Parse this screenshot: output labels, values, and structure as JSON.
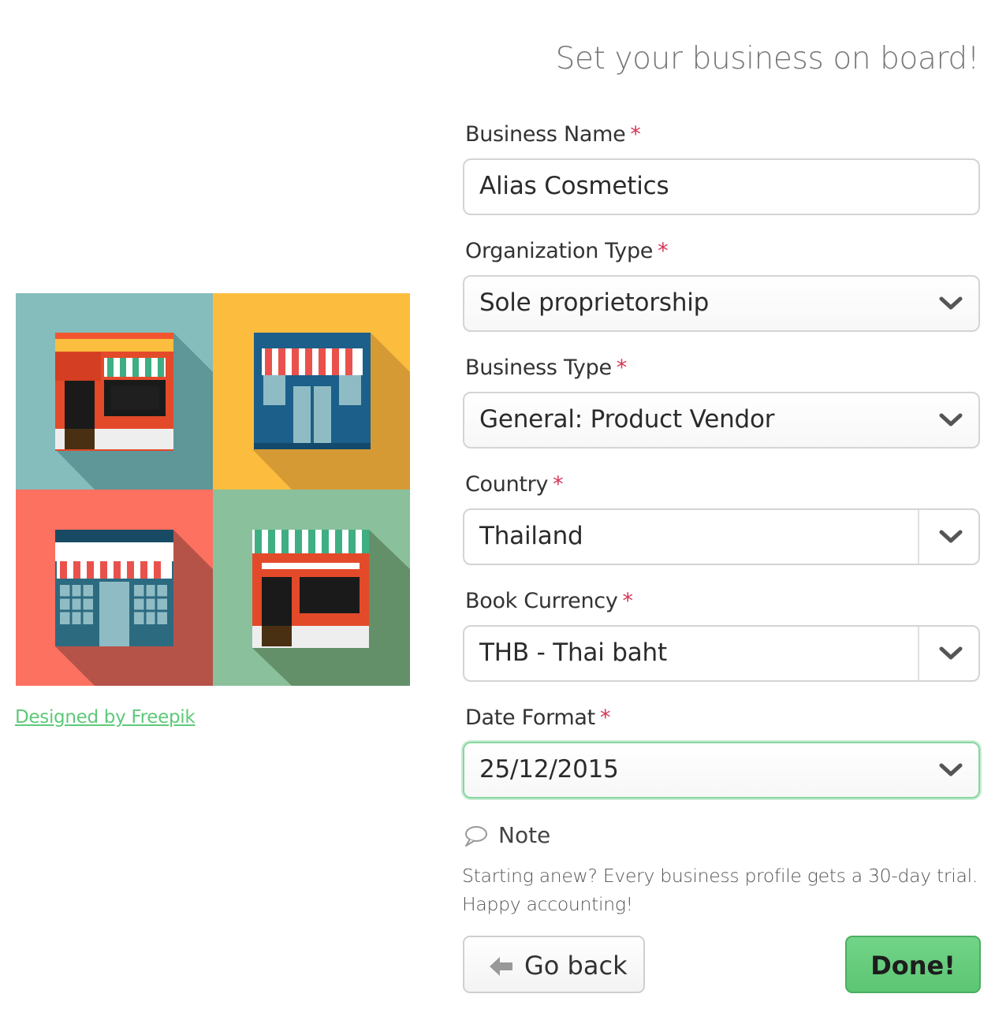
{
  "header": {
    "title": "Set your business on board!"
  },
  "illustration": {
    "credit_link": "Designed by Freepik"
  },
  "form": {
    "business_name": {
      "label": "Business Name",
      "required_mark": "*",
      "value": "Alias Cosmetics"
    },
    "organization_type": {
      "label": "Organization Type",
      "required_mark": "*",
      "value": "Sole proprietorship"
    },
    "business_type": {
      "label": "Business Type",
      "required_mark": "*",
      "value": "General: Product Vendor"
    },
    "country": {
      "label": "Country",
      "required_mark": "*",
      "value": "Thailand"
    },
    "book_currency": {
      "label": "Book Currency",
      "required_mark": "*",
      "value": "THB - Thai baht"
    },
    "date_format": {
      "label": "Date Format",
      "required_mark": "*",
      "value": "25/12/2015"
    }
  },
  "note": {
    "label": "Note",
    "text_line1": "Starting anew? Every business profile gets a 30-day trial.",
    "text_line2": "Happy accounting!"
  },
  "actions": {
    "back_label": "Go back",
    "done_label": "Done!"
  },
  "colors": {
    "required": "#d63555",
    "accent_green": "#5ec97a",
    "focus_border": "#88d6a0"
  },
  "icons": {
    "chevron": "chevron-down-icon",
    "note": "speech-bubble-icon",
    "back": "arrow-left-icon"
  }
}
